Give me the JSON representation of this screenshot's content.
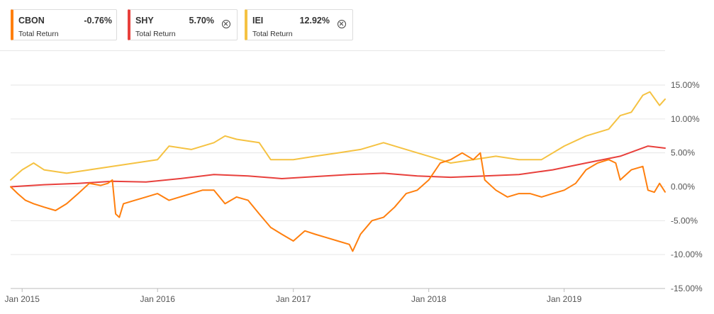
{
  "legend": [
    {
      "ticker": "CBON",
      "value": "-0.76%",
      "subtitle": "Total Return",
      "color": "#ff7f0e",
      "removable": false
    },
    {
      "ticker": "SHY",
      "value": "5.70%",
      "subtitle": "Total Return",
      "color": "#e8403c",
      "removable": true
    },
    {
      "ticker": "IEI",
      "value": "12.92%",
      "subtitle": "Total Return",
      "color": "#f5c242",
      "removable": true
    }
  ],
  "chart_data": {
    "type": "line",
    "title": "",
    "xlabel": "",
    "ylabel": "",
    "x_range": [
      "2014-12-01",
      "2019-09-30"
    ],
    "ylim": [
      -15,
      15
    ],
    "y_ticks": [
      15,
      10,
      5,
      0,
      -5,
      -10,
      -15
    ],
    "y_tick_labels": [
      "15.00%",
      "10.00%",
      "5.00%",
      "0.00%",
      "-5.00%",
      "-10.00%",
      "-15.00%"
    ],
    "x_tick_labels": [
      {
        "date": "2015-01-01",
        "label": "Jan 2015"
      },
      {
        "date": "2016-01-01",
        "label": "Jan 2016"
      },
      {
        "date": "2017-01-01",
        "label": "Jan 2017"
      },
      {
        "date": "2018-01-01",
        "label": "Jan 2018"
      },
      {
        "date": "2019-01-01",
        "label": "Jan 2019"
      }
    ],
    "grid": "horizontal",
    "series": [
      {
        "name": "CBON",
        "color": "#ff7f0e",
        "points": [
          [
            "2014-12-01",
            0.0
          ],
          [
            "2014-12-20",
            -1.0
          ],
          [
            "2015-01-10",
            -2.0
          ],
          [
            "2015-02-01",
            -2.5
          ],
          [
            "2015-03-01",
            -3.0
          ],
          [
            "2015-04-01",
            -3.5
          ],
          [
            "2015-05-01",
            -2.5
          ],
          [
            "2015-06-01",
            -1.0
          ],
          [
            "2015-07-01",
            0.5
          ],
          [
            "2015-08-01",
            0.2
          ],
          [
            "2015-08-20",
            0.5
          ],
          [
            "2015-09-01",
            1.0
          ],
          [
            "2015-09-10",
            -4.0
          ],
          [
            "2015-09-20",
            -4.5
          ],
          [
            "2015-10-01",
            -2.5
          ],
          [
            "2015-11-01",
            -2.0
          ],
          [
            "2015-12-01",
            -1.5
          ],
          [
            "2016-01-01",
            -1.0
          ],
          [
            "2016-02-01",
            -2.0
          ],
          [
            "2016-03-01",
            -1.5
          ],
          [
            "2016-04-01",
            -1.0
          ],
          [
            "2016-05-01",
            -0.5
          ],
          [
            "2016-06-01",
            -0.5
          ],
          [
            "2016-07-01",
            -2.5
          ],
          [
            "2016-08-01",
            -1.5
          ],
          [
            "2016-09-01",
            -2.0
          ],
          [
            "2016-10-01",
            -4.0
          ],
          [
            "2016-11-01",
            -6.0
          ],
          [
            "2016-12-01",
            -7.0
          ],
          [
            "2017-01-01",
            -8.0
          ],
          [
            "2017-02-01",
            -6.5
          ],
          [
            "2017-03-01",
            -7.0
          ],
          [
            "2017-04-01",
            -7.5
          ],
          [
            "2017-05-01",
            -8.0
          ],
          [
            "2017-06-01",
            -8.5
          ],
          [
            "2017-06-10",
            -9.5
          ],
          [
            "2017-07-01",
            -7.0
          ],
          [
            "2017-08-01",
            -5.0
          ],
          [
            "2017-09-01",
            -4.5
          ],
          [
            "2017-10-01",
            -3.0
          ],
          [
            "2017-11-01",
            -1.0
          ],
          [
            "2017-12-01",
            -0.5
          ],
          [
            "2018-01-01",
            1.0
          ],
          [
            "2018-02-01",
            3.5
          ],
          [
            "2018-03-01",
            4.0
          ],
          [
            "2018-04-01",
            5.0
          ],
          [
            "2018-05-01",
            4.0
          ],
          [
            "2018-05-20",
            5.0
          ],
          [
            "2018-06-01",
            1.0
          ],
          [
            "2018-07-01",
            -0.5
          ],
          [
            "2018-08-01",
            -1.5
          ],
          [
            "2018-09-01",
            -1.0
          ],
          [
            "2018-10-01",
            -1.0
          ],
          [
            "2018-11-01",
            -1.5
          ],
          [
            "2018-12-01",
            -1.0
          ],
          [
            "2019-01-01",
            -0.5
          ],
          [
            "2019-02-01",
            0.5
          ],
          [
            "2019-03-01",
            2.5
          ],
          [
            "2019-04-01",
            3.5
          ],
          [
            "2019-05-01",
            4.0
          ],
          [
            "2019-05-20",
            3.5
          ],
          [
            "2019-06-01",
            1.0
          ],
          [
            "2019-07-01",
            2.5
          ],
          [
            "2019-08-01",
            3.0
          ],
          [
            "2019-08-15",
            -0.5
          ],
          [
            "2019-09-01",
            -0.8
          ],
          [
            "2019-09-15",
            0.5
          ],
          [
            "2019-09-30",
            -0.76
          ]
        ]
      },
      {
        "name": "SHY",
        "color": "#e8403c",
        "points": [
          [
            "2014-12-01",
            0.0
          ],
          [
            "2015-03-01",
            0.3
          ],
          [
            "2015-06-01",
            0.5
          ],
          [
            "2015-09-01",
            0.8
          ],
          [
            "2015-12-01",
            0.7
          ],
          [
            "2016-03-01",
            1.2
          ],
          [
            "2016-06-01",
            1.8
          ],
          [
            "2016-09-01",
            1.6
          ],
          [
            "2016-12-01",
            1.2
          ],
          [
            "2017-03-01",
            1.5
          ],
          [
            "2017-06-01",
            1.8
          ],
          [
            "2017-09-01",
            2.0
          ],
          [
            "2017-12-01",
            1.6
          ],
          [
            "2018-03-01",
            1.4
          ],
          [
            "2018-06-01",
            1.6
          ],
          [
            "2018-09-01",
            1.8
          ],
          [
            "2018-12-01",
            2.5
          ],
          [
            "2019-03-01",
            3.5
          ],
          [
            "2019-06-01",
            4.5
          ],
          [
            "2019-08-15",
            6.0
          ],
          [
            "2019-09-30",
            5.7
          ]
        ]
      },
      {
        "name": "IEI",
        "color": "#f5c242",
        "points": [
          [
            "2014-12-01",
            1.0
          ],
          [
            "2015-01-01",
            2.5
          ],
          [
            "2015-02-01",
            3.5
          ],
          [
            "2015-03-01",
            2.5
          ],
          [
            "2015-05-01",
            2.0
          ],
          [
            "2015-07-01",
            2.5
          ],
          [
            "2015-09-01",
            3.0
          ],
          [
            "2015-11-01",
            3.5
          ],
          [
            "2016-01-01",
            4.0
          ],
          [
            "2016-02-01",
            6.0
          ],
          [
            "2016-04-01",
            5.5
          ],
          [
            "2016-06-01",
            6.5
          ],
          [
            "2016-07-01",
            7.5
          ],
          [
            "2016-08-01",
            7.0
          ],
          [
            "2016-10-01",
            6.5
          ],
          [
            "2016-11-01",
            4.0
          ],
          [
            "2017-01-01",
            4.0
          ],
          [
            "2017-03-01",
            4.5
          ],
          [
            "2017-05-01",
            5.0
          ],
          [
            "2017-07-01",
            5.5
          ],
          [
            "2017-09-01",
            6.5
          ],
          [
            "2017-11-01",
            5.5
          ],
          [
            "2018-01-01",
            4.5
          ],
          [
            "2018-03-01",
            3.5
          ],
          [
            "2018-05-01",
            4.0
          ],
          [
            "2018-07-01",
            4.5
          ],
          [
            "2018-09-01",
            4.0
          ],
          [
            "2018-11-01",
            4.0
          ],
          [
            "2019-01-01",
            6.0
          ],
          [
            "2019-03-01",
            7.5
          ],
          [
            "2019-05-01",
            8.5
          ],
          [
            "2019-06-01",
            10.5
          ],
          [
            "2019-07-01",
            11.0
          ],
          [
            "2019-08-01",
            13.5
          ],
          [
            "2019-08-20",
            14.0
          ],
          [
            "2019-09-15",
            12.0
          ],
          [
            "2019-09-30",
            12.92
          ]
        ]
      }
    ]
  }
}
